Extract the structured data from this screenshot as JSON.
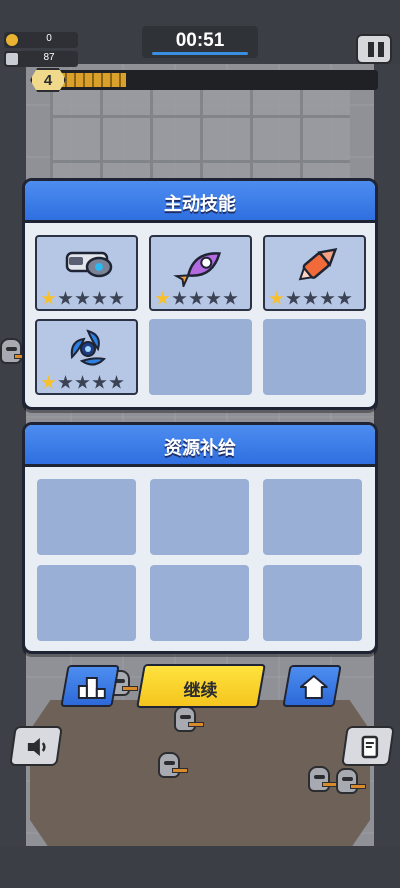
{
  "hud": {
    "coins": "0",
    "gems": "87",
    "timer": "00:51",
    "level": "4",
    "xp_progress": 0.2
  },
  "skills_panel": {
    "title": "主动技能",
    "items": [
      {
        "icon": "drone-gun-icon",
        "stars": 1,
        "max_stars": 5
      },
      {
        "icon": "rocket-icon",
        "stars": 1,
        "max_stars": 5
      },
      {
        "icon": "drill-bullet-icon",
        "stars": 1,
        "max_stars": 5
      },
      {
        "icon": "spinner-blade-icon",
        "stars": 1,
        "max_stars": 5
      }
    ],
    "empty_slots": 2
  },
  "supply_panel": {
    "title": "资源补给",
    "empty_slots": 6
  },
  "buttons": {
    "continue_label": "继续"
  },
  "colors": {
    "panel_header": "#3b7be6",
    "continue": "#f9d62b",
    "star_on": "#f7c02c",
    "star_off": "#3b4254"
  }
}
